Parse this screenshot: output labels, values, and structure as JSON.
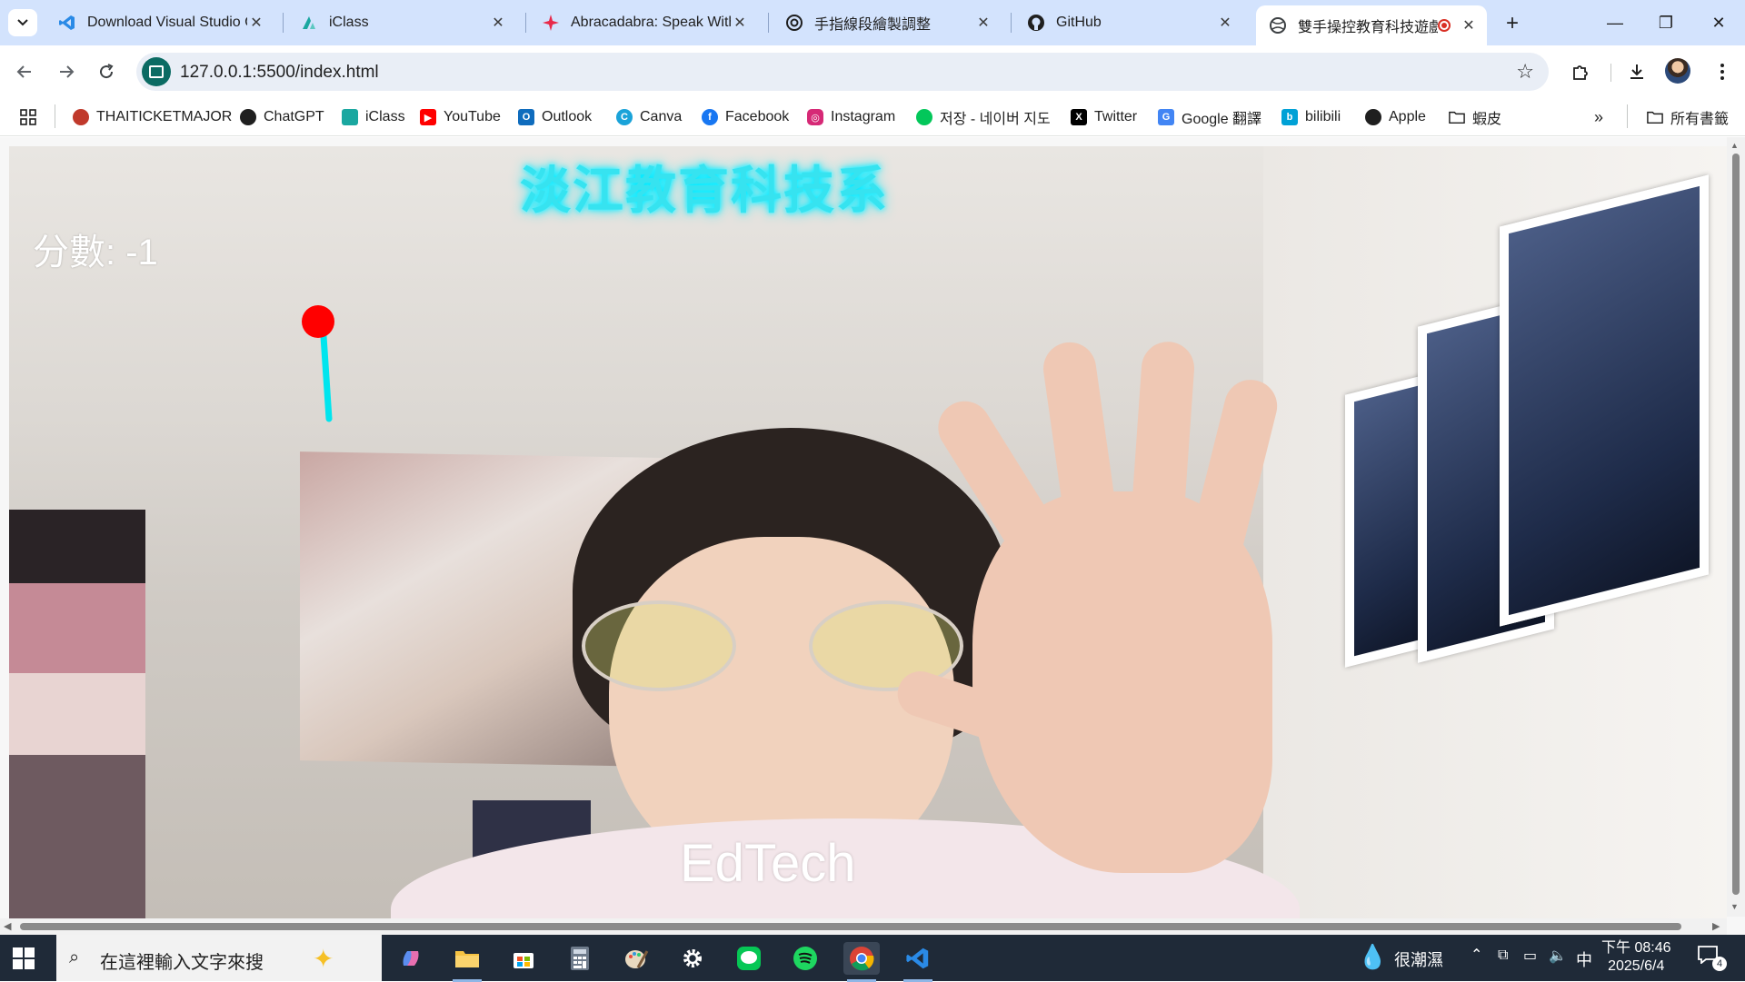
{
  "browser": {
    "tabs": [
      {
        "title": "Download Visual Studio C",
        "icon": "vscode-icon",
        "active": false
      },
      {
        "title": "iClass",
        "icon": "iclass-icon",
        "active": false
      },
      {
        "title": "Abracadabra: Speak With",
        "icon": "abracadabra-icon",
        "active": false
      },
      {
        "title": "手指線段繪製調整",
        "icon": "chatgpt-icon",
        "active": false
      },
      {
        "title": "GitHub",
        "icon": "github-icon",
        "active": false
      },
      {
        "title": "雙手操控教育科技遊戲",
        "icon": "globe-icon",
        "active": true,
        "recording": true
      }
    ],
    "url": "127.0.0.1:5500/index.html",
    "bookmarks": [
      {
        "label": "THAITICKETMAJOR",
        "icon": "thaiticket-icon",
        "color": "#c0392b"
      },
      {
        "label": "ChatGPT",
        "icon": "chatgpt-icon",
        "color": "#1f1f1f"
      },
      {
        "label": "iClass",
        "icon": "iclass-icon",
        "color": "#1aa7a0"
      },
      {
        "label": "YouTube",
        "icon": "youtube-icon",
        "color": "#ff0000"
      },
      {
        "label": "Outlook",
        "icon": "outlook-icon",
        "color": "#0f6cbd"
      },
      {
        "label": "Canva",
        "icon": "canva-icon",
        "color": "#1aa3d9"
      },
      {
        "label": "Facebook",
        "icon": "facebook-icon",
        "color": "#1877f2"
      },
      {
        "label": "Instagram",
        "icon": "instagram-icon",
        "color": "#d62976"
      },
      {
        "label": "저장 - 네이버 지도",
        "icon": "naver-map-icon",
        "color": "#03c75a"
      },
      {
        "label": "Twitter",
        "icon": "x-icon",
        "color": "#000000"
      },
      {
        "label": "Google 翻譯",
        "icon": "google-translate-icon",
        "color": "#4285f4"
      },
      {
        "label": "bilibili",
        "icon": "bilibili-icon",
        "color": "#00a1d6"
      },
      {
        "label": "Apple",
        "icon": "apple-icon",
        "color": "#1f1f1f"
      },
      {
        "label": "蝦皮",
        "icon": "folder-icon",
        "color": "#5f6368"
      }
    ],
    "all_bookmarks_label": "所有書籤"
  },
  "game": {
    "title": "淡江教育科技系",
    "score_text": "分數: -1",
    "word": "EdTech",
    "title_color": "#36e3f0",
    "pointer_color": "#ff0000",
    "line_color": "#00e5ee"
  },
  "taskbar": {
    "search_placeholder": "在這裡輸入文字來搜",
    "weather": "很潮濕",
    "ime": "中",
    "time": "下午 08:46",
    "date": "2025/6/4",
    "notification_count": "4"
  }
}
